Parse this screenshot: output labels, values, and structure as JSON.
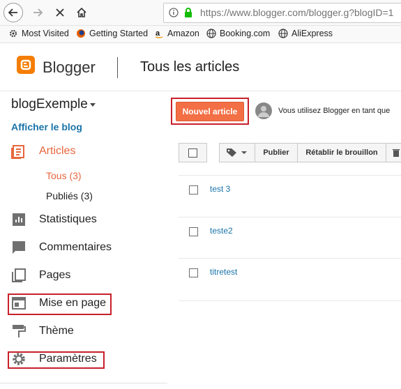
{
  "browser": {
    "url": "https://www.blogger.com/blogger.g?blogID=1",
    "bookmarks": [
      {
        "label": "Most Visited",
        "icon": "gear-icon"
      },
      {
        "label": "Getting Started",
        "icon": "firefox-icon"
      },
      {
        "label": "Amazon",
        "icon": "amazon-icon"
      },
      {
        "label": "Booking.com",
        "icon": "globe-icon"
      },
      {
        "label": "AliExpress",
        "icon": "globe-icon"
      }
    ]
  },
  "header": {
    "app_name": "Blogger",
    "page_title": "Tous les articles"
  },
  "sidebar": {
    "blog_name": "blogExemple",
    "view_blog": "Afficher le blog",
    "items": [
      {
        "label": "Articles",
        "icon": "articles-icon",
        "active": true
      },
      {
        "label": "Statistiques",
        "icon": "stats-icon"
      },
      {
        "label": "Commentaires",
        "icon": "comment-icon"
      },
      {
        "label": "Pages",
        "icon": "pages-icon"
      },
      {
        "label": "Mise en page",
        "icon": "layout-icon"
      },
      {
        "label": "Thème",
        "icon": "theme-icon"
      },
      {
        "label": "Paramètres",
        "icon": "settings-icon"
      }
    ],
    "sub_items": [
      {
        "label": "Tous (3)",
        "active": true
      },
      {
        "label": "Publiés (3)"
      }
    ]
  },
  "main": {
    "new_post": "Nouvel article",
    "user_text": "Vous utilisez Blogger en tant que",
    "actions": {
      "publish": "Publier",
      "revert": "Rétablir le brouillon"
    },
    "posts": [
      "test 3",
      "teste2",
      "titretest"
    ]
  },
  "colors": {
    "accent": "#f57d00",
    "active_nav": "#e8663d",
    "link": "#1a73a8",
    "highlight_box": "#c8202a"
  }
}
